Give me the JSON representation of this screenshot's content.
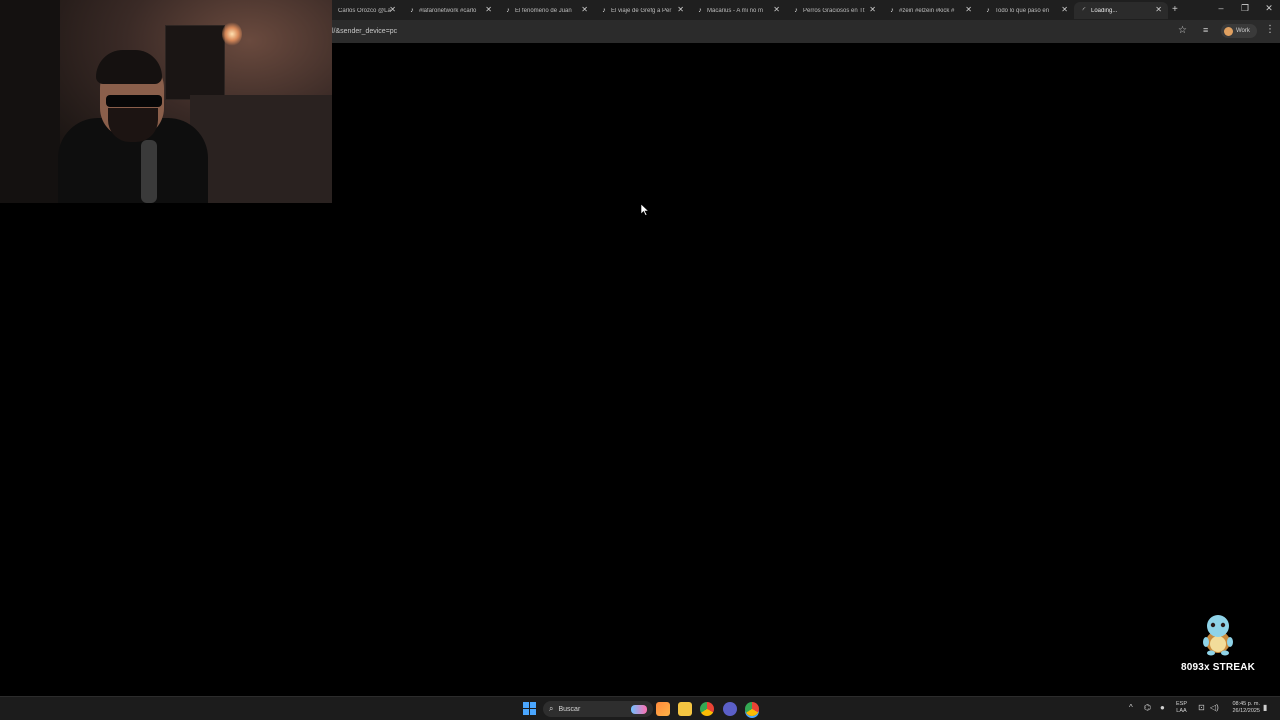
{
  "browser": {
    "tabs": [
      {
        "title": "Carlos Orozco @La",
        "icon": "tiktok-icon",
        "active": false
      },
      {
        "title": "#lafaronetwork #carlo",
        "icon": "tiktok-icon",
        "active": false
      },
      {
        "title": "El fenómeno de Juan",
        "icon": "tiktok-icon",
        "active": false
      },
      {
        "title": "El viaje de Grefg a Per",
        "icon": "tiktok-icon",
        "active": false
      },
      {
        "title": "Macarius - A mi no m",
        "icon": "tiktok-icon",
        "active": false
      },
      {
        "title": "Perros Graciosos en Tt",
        "icon": "tiktok-icon",
        "active": false
      },
      {
        "title": "#zein #elzein #kick #",
        "icon": "tiktok-icon",
        "active": false
      },
      {
        "title": "Todo lo que pasó en",
        "icon": "tiktok-icon",
        "active": false
      },
      {
        "title": "Loading...",
        "icon": "loading-spinner-icon",
        "active": true
      }
    ],
    "new_tab_label": "+",
    "window_controls": {
      "minimize": "–",
      "restore": "❐",
      "close": "✕"
    },
    "address": "l/&sender_device=pc",
    "profile_label": "Work"
  },
  "overlay": {
    "streak_text": "8093x STREAK",
    "mascot": "squirtle-icon"
  },
  "taskbar": {
    "search_placeholder": "Buscar",
    "language_top": "ESP",
    "language_bottom": "LAA",
    "time": "08:45 p. m.",
    "date": "26/12/2025"
  },
  "colors": {
    "background": "#000000",
    "tabstrip": "#1f1f1f",
    "toolbar": "#2b2b2b",
    "taskbar": "#1c1c1c",
    "windows_accent": "#4aa6ff"
  }
}
